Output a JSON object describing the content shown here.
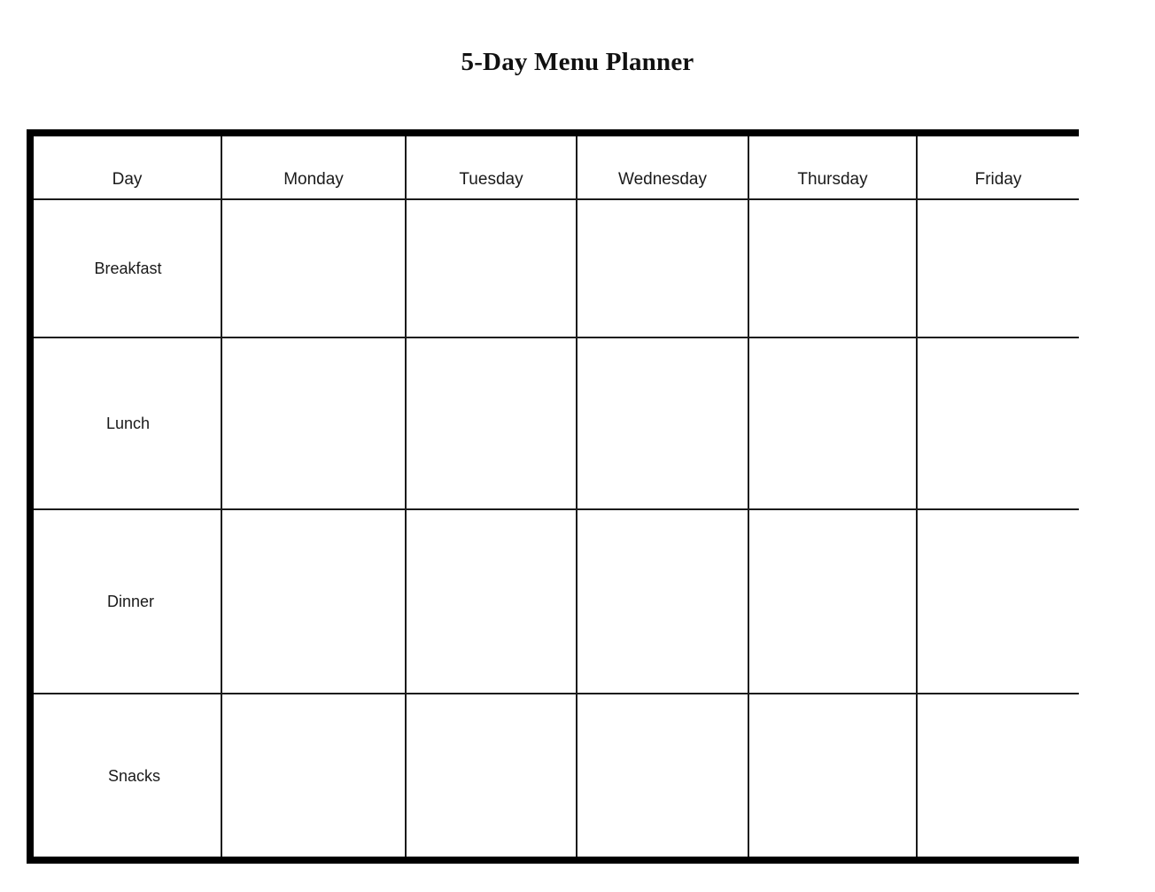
{
  "page": {
    "title": "5-Day Menu Planner",
    "background_color": "#ffffff",
    "border_color": "#000000",
    "grid_line_color": "#1a1a1a",
    "text_color": "#1a1a1a"
  },
  "table": {
    "headers": [
      "Day",
      "Monday",
      "Tuesday",
      "Wednesday",
      "Thursday",
      "Friday"
    ],
    "rows": [
      {
        "label": "Breakfast",
        "cells": [
          "",
          "",
          "",
          "",
          ""
        ]
      },
      {
        "label": "Lunch",
        "cells": [
          "",
          "",
          "",
          "",
          ""
        ]
      },
      {
        "label": "Dinner",
        "cells": [
          "",
          "",
          "",
          "",
          ""
        ]
      },
      {
        "label": "Snacks",
        "cells": [
          "",
          "",
          "",
          "",
          ""
        ]
      }
    ]
  }
}
